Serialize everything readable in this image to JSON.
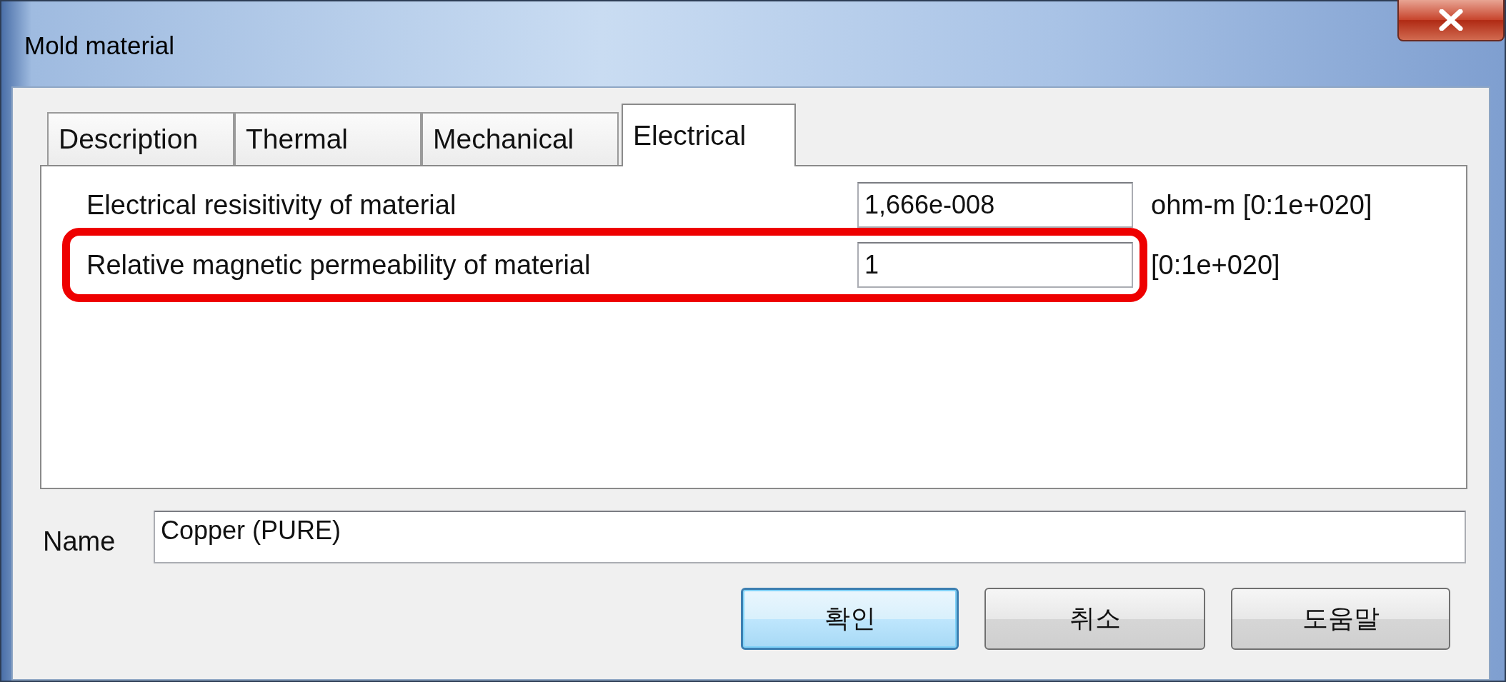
{
  "window": {
    "title": "Mold material"
  },
  "tabs": [
    {
      "label": "Description",
      "selected": false
    },
    {
      "label": "Thermal",
      "selected": false
    },
    {
      "label": "Mechanical",
      "selected": false
    },
    {
      "label": "Electrical",
      "selected": true
    }
  ],
  "properties": [
    {
      "label": "Electrical resisitivity of material",
      "value": "1,666e-008",
      "unit": "ohm-m [0:1e+020]",
      "highlighted": false
    },
    {
      "label": "Relative magnetic permeability of material",
      "value": "1",
      "unit": "[0:1e+020]",
      "highlighted": true
    }
  ],
  "name_field": {
    "label": "Name",
    "value": "Copper (PURE)"
  },
  "buttons": [
    {
      "label": "확인",
      "default": true
    },
    {
      "label": "취소",
      "default": false
    },
    {
      "label": "도움말",
      "default": false
    }
  ]
}
